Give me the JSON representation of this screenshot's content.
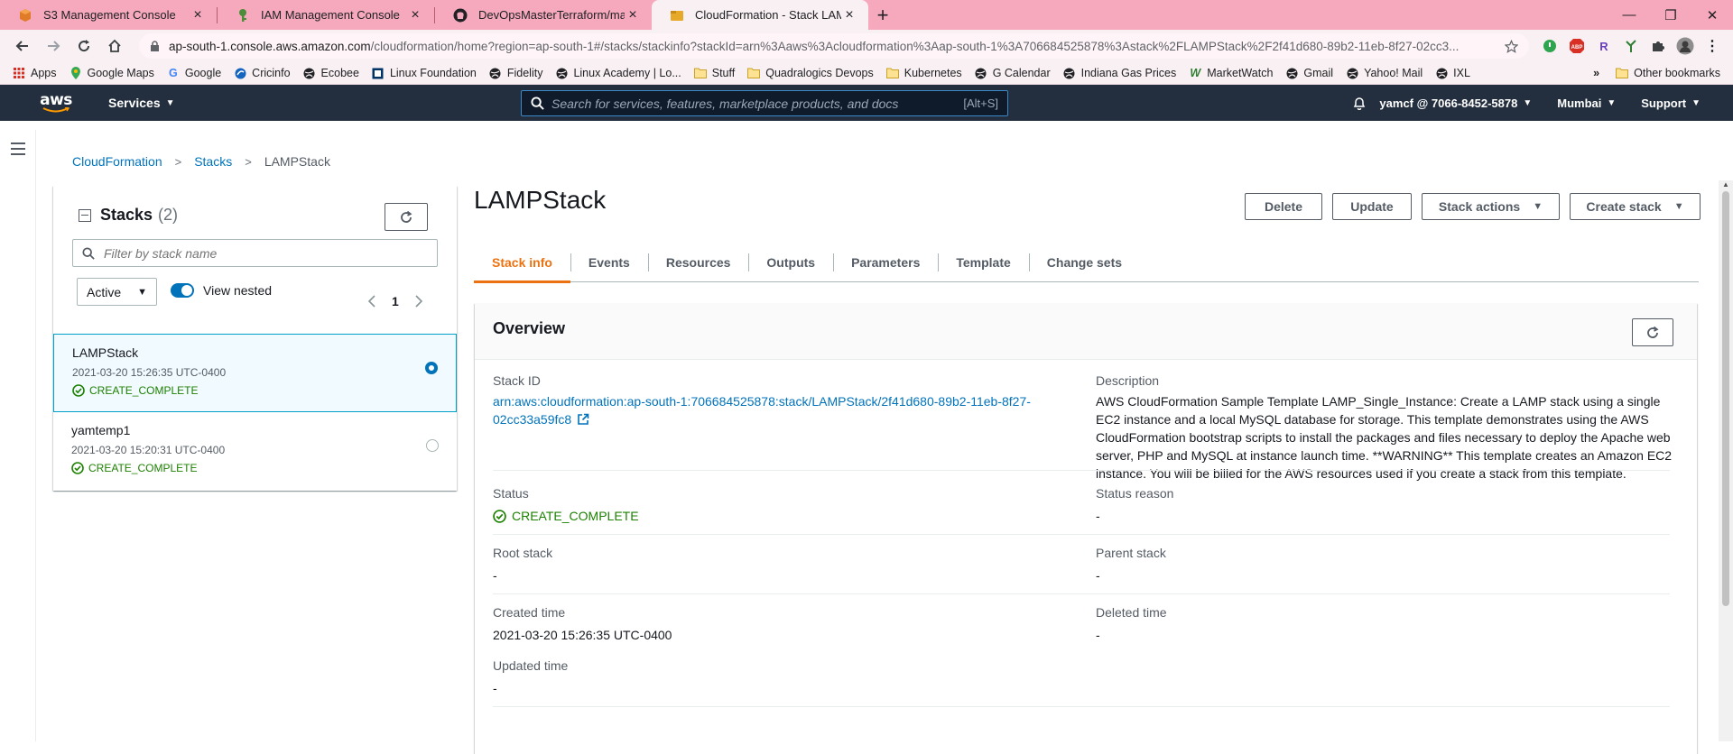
{
  "browser": {
    "tabs": [
      {
        "title": "S3 Management Console",
        "icon": "aws-s3-icon"
      },
      {
        "title": "IAM Management Console",
        "icon": "aws-iam-icon"
      },
      {
        "title": "DevOpsMasterTerraform/main.tf",
        "icon": "github-icon"
      },
      {
        "title": "CloudFormation - Stack LAMPStack",
        "icon": "aws-cloudformation-icon"
      }
    ],
    "url_host": "ap-south-1.console.aws.amazon.com",
    "url_path": "/cloudformation/home?region=ap-south-1#/stacks/stackinfo?stackId=arn%3Aaws%3Acloudformation%3Aap-south-1%3A706684525878%3Astack%2FLAMPStack%2F2f41d680-89b2-11eb-8f27-02cc3...",
    "bookmarks": [
      "Apps",
      "Google Maps",
      "Google",
      "Cricinfo",
      "Ecobee",
      "Linux Foundation",
      "Fidelity",
      "Linux Academy | Lo...",
      "Stuff",
      "Quadralogics Devops",
      "Kubernetes",
      "G Calendar",
      "Indiana Gas Prices",
      "MarketWatch",
      "Gmail",
      "Yahoo! Mail",
      "IXL"
    ],
    "other_bookmarks": "Other bookmarks",
    "more_bookmarks": "»"
  },
  "aws": {
    "logo": "aws",
    "services": "Services",
    "search_placeholder": "Search for services, features, marketplace products, and docs",
    "search_shortcut": "[Alt+S]",
    "account": "yamcf @ 7066-8452-5878",
    "region": "Mumbai",
    "support": "Support"
  },
  "breadcrumb": {
    "root": "CloudFormation",
    "mid": "Stacks",
    "current": "LAMPStack"
  },
  "stacks_panel": {
    "title": "Stacks",
    "count": "(2)",
    "filter_placeholder": "Filter by stack name",
    "status_filter": "Active",
    "view_nested": "View nested",
    "page": "1",
    "stacks": [
      {
        "name": "LAMPStack",
        "time": "2021-03-20 15:26:35 UTC-0400",
        "status": "CREATE_COMPLETE",
        "selected": true
      },
      {
        "name": "yamtemp1",
        "time": "2021-03-20 15:20:31 UTC-0400",
        "status": "CREATE_COMPLETE",
        "selected": false
      }
    ]
  },
  "detail": {
    "title": "LAMPStack",
    "buttons": {
      "delete": "Delete",
      "update": "Update",
      "stack_actions": "Stack actions",
      "create_stack": "Create stack"
    },
    "tabs": [
      "Stack info",
      "Events",
      "Resources",
      "Outputs",
      "Parameters",
      "Template",
      "Change sets"
    ],
    "active_tab": "Stack info"
  },
  "overview": {
    "heading": "Overview",
    "stack_id_label": "Stack ID",
    "stack_id_line1": "arn:aws:cloudformation:ap-south-1:706684525878:stack/LAMPStack/2f41d680-89b2-11eb-8f27-",
    "stack_id_line2": "02cc33a59fc8",
    "description_label": "Description",
    "description": "AWS CloudFormation Sample Template LAMP_Single_Instance: Create a LAMP stack using a single EC2 instance and a local MySQL database for storage. This template demonstrates using the AWS CloudFormation bootstrap scripts to install the packages and files necessary to deploy the Apache web server, PHP and MySQL at instance launch time. **WARNING** This template creates an Amazon EC2 instance. You will be billed for the AWS resources used if you create a stack from this template.",
    "status_label": "Status",
    "status": "CREATE_COMPLETE",
    "status_reason_label": "Status reason",
    "status_reason": "-",
    "root_stack_label": "Root stack",
    "root_stack": "-",
    "parent_stack_label": "Parent stack",
    "parent_stack": "-",
    "created_time_label": "Created time",
    "created_time": "2021-03-20 15:26:35 UTC-0400",
    "deleted_time_label": "Deleted time",
    "deleted_time": "-",
    "updated_time_label": "Updated time",
    "updated_time": "-"
  },
  "colors": {
    "aws_nav": "#232f3e",
    "link": "#0073bb",
    "success": "#1d8102",
    "active_tab": "#ec7211",
    "chrome_tabbar": "#f6a9bd"
  }
}
